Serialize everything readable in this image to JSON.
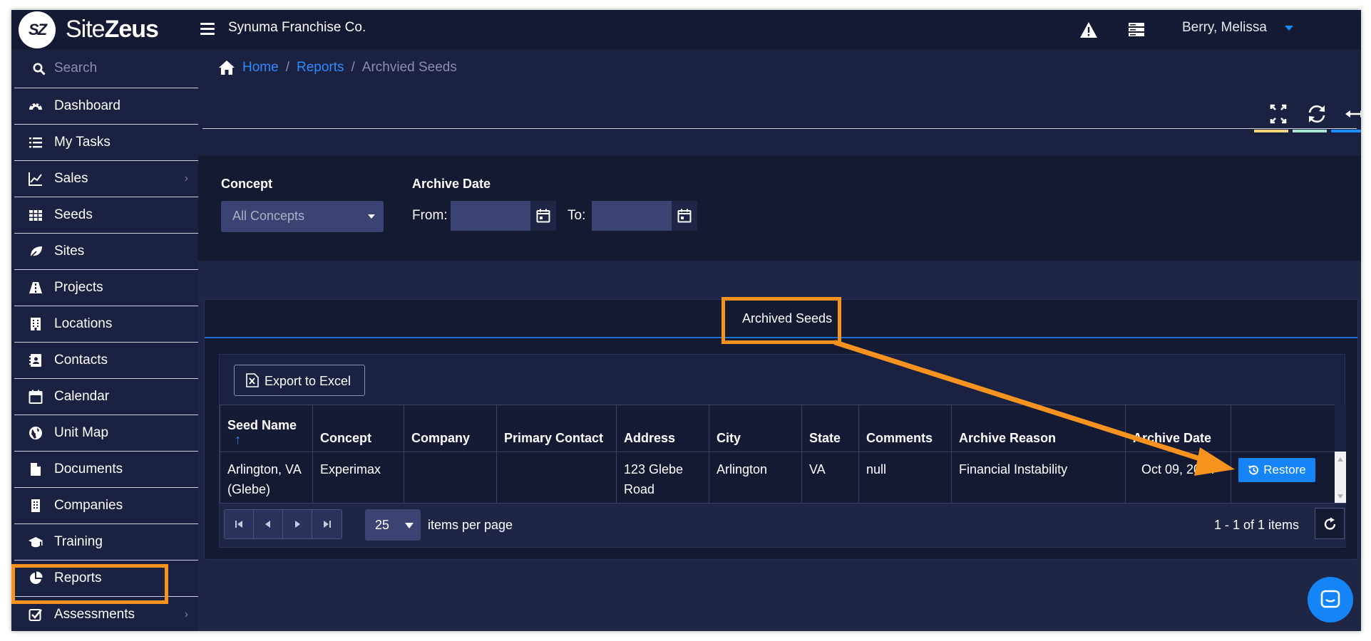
{
  "app": {
    "logo_mark": "SZ",
    "logo_text_light": "Site",
    "logo_text_bold": "Zeus",
    "company": "Synuma Franchise Co.",
    "user": "Berry, Melissa"
  },
  "sidebar": {
    "search_placeholder": "Search",
    "items": [
      {
        "label": "Dashboard",
        "icon": "dashboard-icon"
      },
      {
        "label": "My Tasks",
        "icon": "tasks-list-icon"
      },
      {
        "label": "Sales",
        "icon": "line-chart-icon",
        "has_chevron": true
      },
      {
        "label": "Seeds",
        "icon": "grid-icon"
      },
      {
        "label": "Sites",
        "icon": "leaf-icon"
      },
      {
        "label": "Projects",
        "icon": "road-icon"
      },
      {
        "label": "Locations",
        "icon": "building-icon"
      },
      {
        "label": "Contacts",
        "icon": "address-book-icon"
      },
      {
        "label": "Calendar",
        "icon": "calendar-icon"
      },
      {
        "label": "Unit Map",
        "icon": "globe-icon"
      },
      {
        "label": "Documents",
        "icon": "document-icon"
      },
      {
        "label": "Companies",
        "icon": "office-building-icon"
      },
      {
        "label": "Training",
        "icon": "graduation-cap-icon"
      },
      {
        "label": "Reports",
        "icon": "pie-chart-icon",
        "active": true
      },
      {
        "label": "Assessments",
        "icon": "checkbox-icon",
        "has_chevron": true
      }
    ],
    "chevron": "›"
  },
  "breadcrumb": {
    "home": "Home",
    "reports": "Reports",
    "current": "Archvied Seeds",
    "separator": "/"
  },
  "filters": {
    "concept_label": "Concept",
    "concept_value": "All Concepts",
    "archive_date_label": "Archive Date",
    "from_label": "From:",
    "to_label": "To:"
  },
  "tab": {
    "label": "Archived Seeds"
  },
  "grid": {
    "export_label": "Export to Excel",
    "sort_indicator": "↑",
    "columns": [
      "Seed Name",
      "Concept",
      "Company",
      "Primary Contact",
      "Address",
      "City",
      "State",
      "Comments",
      "Archive Reason",
      "Archive Date",
      ""
    ],
    "rows": [
      {
        "seed_name": "Arlington, VA (Glebe)",
        "concept": "Experimax",
        "company": "",
        "primary_contact": "",
        "address": "123 Glebe Road",
        "city": "Arlington",
        "state": "VA",
        "comments": "null",
        "archive_reason": "Financial Instability",
        "archive_date": "Oct 09, 2024",
        "action": "Restore"
      }
    ],
    "page_size": "25",
    "items_per_page": "items per page",
    "pager_info": "1 - 1 of 1 items"
  },
  "colors": {
    "accent": "#1484f6",
    "annotation": "#f7931e",
    "tool_bar_1": "#f5d67a",
    "tool_bar_2": "#a8e6cf",
    "tool_bar_3": "#1a8cff"
  }
}
